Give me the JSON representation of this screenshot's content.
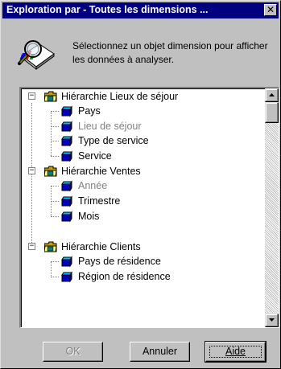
{
  "window": {
    "title": "Exploration par - Toutes les dimensions ...",
    "close_glyph": "✕"
  },
  "instruction_text": "Sélectionnez un objet dimension pour afficher les données à analyser.",
  "header_icon": "magnifier-document-icon",
  "tree": {
    "hierarchies": [
      {
        "label": "Hiérarchie Lieux de séjour",
        "icon": "folder-hierarchy-icon",
        "expander": "−",
        "items": [
          {
            "label": "Pays",
            "disabled": false,
            "icon": "dimension-cube-icon"
          },
          {
            "label": "Lieu de séjour",
            "disabled": true,
            "icon": "dimension-cube-icon"
          },
          {
            "label": "Type de service",
            "disabled": false,
            "icon": "dimension-cube-icon"
          },
          {
            "label": "Service",
            "disabled": false,
            "icon": "dimension-cube-icon"
          }
        ]
      },
      {
        "label": "Hiérarchie Ventes",
        "icon": "folder-hierarchy-icon",
        "expander": "−",
        "items": [
          {
            "label": "Année",
            "disabled": true,
            "icon": "dimension-cube-icon"
          },
          {
            "label": "Trimestre",
            "disabled": false,
            "icon": "dimension-cube-icon"
          },
          {
            "label": "Mois",
            "disabled": false,
            "icon": "dimension-cube-icon"
          }
        ]
      },
      {
        "label": "Hiérarchie Clients",
        "icon": "folder-hierarchy-icon",
        "expander": "−",
        "items": [
          {
            "label": "Pays de résidence",
            "disabled": false,
            "icon": "dimension-cube-icon"
          },
          {
            "label": "Région de résidence",
            "disabled": false,
            "icon": "dimension-cube-icon"
          }
        ]
      }
    ]
  },
  "buttons": {
    "ok": {
      "label": "OK",
      "disabled": true
    },
    "cancel": {
      "label": "Annuler",
      "disabled": false
    },
    "help": {
      "label": "Aide",
      "disabled": false,
      "mnemonic": "A"
    }
  },
  "colors": {
    "title_bar": "#000080",
    "face": "#c0c0c0",
    "disabled_text": "#808080"
  }
}
